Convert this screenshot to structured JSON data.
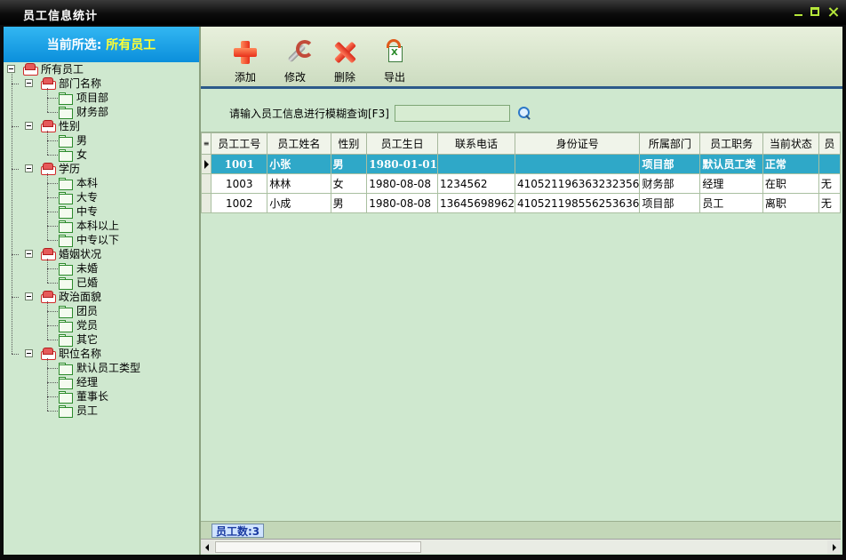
{
  "window": {
    "title": "员工信息统计"
  },
  "left_panel": {
    "header_prefix": "当前所选:",
    "header_selected": "所有员工",
    "tree": {
      "root": "所有员工",
      "groups": [
        {
          "label": "部门名称",
          "children": [
            "项目部",
            "财务部"
          ]
        },
        {
          "label": "性别",
          "children": [
            "男",
            "女"
          ]
        },
        {
          "label": "学历",
          "children": [
            "本科",
            "大专",
            "中专",
            "本科以上",
            "中专以下"
          ]
        },
        {
          "label": "婚姻状况",
          "children": [
            "未婚",
            "已婚"
          ]
        },
        {
          "label": "政治面貌",
          "children": [
            "团员",
            "党员",
            "其它"
          ]
        },
        {
          "label": "职位名称",
          "children": [
            "默认员工类型",
            "经理",
            "董事长",
            "员工"
          ]
        }
      ]
    }
  },
  "toolbar": {
    "add": "添加",
    "edit": "修改",
    "delete": "删除",
    "export": "导出"
  },
  "search": {
    "label": "请输入员工信息进行模糊查询[F3]",
    "value": ""
  },
  "grid": {
    "columns": [
      "员工工号",
      "员工姓名",
      "性别",
      "员工生日",
      "联系电话",
      "身份证号",
      "所属部门",
      "员工职务",
      "当前状态",
      "员"
    ],
    "rows": [
      {
        "selected": true,
        "cells": [
          "1001",
          "小张",
          "男",
          "1980-01-01",
          "",
          "",
          "项目部",
          "默认员工类",
          "正常",
          ""
        ]
      },
      {
        "selected": false,
        "cells": [
          "1003",
          "林林",
          "女",
          "1980-08-08",
          "1234562",
          "410521196363232356",
          "财务部",
          "经理",
          "在职",
          "无"
        ]
      },
      {
        "selected": false,
        "cells": [
          "1002",
          "小成",
          "男",
          "1980-08-08",
          "13645698962",
          "410521198556253636",
          "项目部",
          "员工",
          "离职",
          "无"
        ]
      }
    ]
  },
  "status": {
    "count_label": "员工数:3"
  }
}
